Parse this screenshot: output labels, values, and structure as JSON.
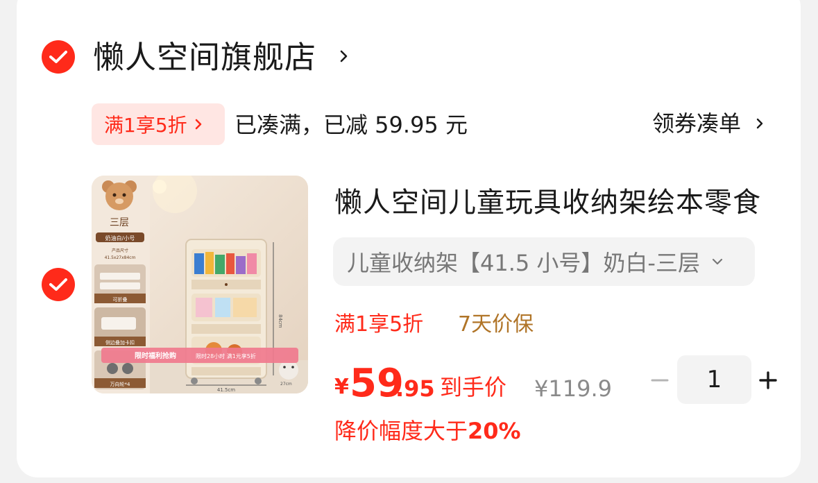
{
  "store": {
    "name": "懒人空间旗舰店"
  },
  "promo": {
    "tag": "满1享5折",
    "status": "已凑满，已减 59.95 元",
    "coupon_link": "领券凑单"
  },
  "product": {
    "title": "懒人空间儿童玩具收纳架绘本零食",
    "sku": "儿童收纳架【41.5 小号】奶白-三层",
    "tags": {
      "discount": "满1享5折",
      "guarantee": "7天价保"
    },
    "price": {
      "currency": "¥",
      "integer": "59",
      "decimal": ".95",
      "final_label": "到手价",
      "original": "¥119.9"
    },
    "quantity": "1",
    "price_drop_prefix": "降价幅度大于",
    "price_drop_value": "20%",
    "image_text": {
      "tier": "三层",
      "color": "奶油白/小号",
      "size_label": "产品尺寸",
      "size_value": "41.5x27x84cm",
      "foldable": "可折叠",
      "side_clip": "侧边叠加卡扣",
      "wheels": "万向轮*4",
      "banner": "限时福利抢购",
      "banner2": "限时28小时 满1元享5折",
      "width_dim": "41.5cm",
      "height_dim": "84cm",
      "depth_dim": "27cm"
    }
  },
  "colors": {
    "accent": "#ff2a1a",
    "guarantee": "#b07427",
    "promo_bg": "#ffe6e3"
  }
}
